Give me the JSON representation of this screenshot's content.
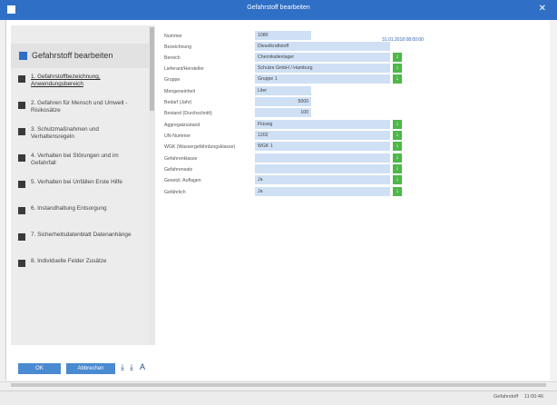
{
  "window": {
    "title": "Gefahrstoff bearbeiten",
    "close_glyph": "✕"
  },
  "sidebar": {
    "header": "Gefahrstoff bearbeiten",
    "items": [
      {
        "label": "1. Gefahrstoffbezeichnung, Anwendungsbereich"
      },
      {
        "label": "2. Gefahren für Mensch und Umwelt - Risikosätze"
      },
      {
        "label": "3. Schutzmaßnahmen und Verhaltensregeln"
      },
      {
        "label": "4. Verhalten bei Störungen und im Gefahrfall"
      },
      {
        "label": "5. Verhalten bei Unfällen Erste Hilfe"
      },
      {
        "label": "6. Instandhaltung Entsorgung"
      },
      {
        "label": "7. Sicherheitsdatenblatt Datenanhänge"
      },
      {
        "label": "8. Individuelle Felder Zusätze"
      }
    ]
  },
  "buttons": {
    "ok": "OK",
    "cancel": "Abbrechen"
  },
  "toolbar": {
    "tool1": "⤓",
    "tool2": "⤓",
    "tool3": "A"
  },
  "form": {
    "date": "31.01.2018 08:00:00",
    "fields": [
      {
        "label": "Nummer",
        "value": "1080",
        "dropdown": false
      },
      {
        "label": "Bezeichnung",
        "value": "Dieselkraftstoff",
        "dropdown": false
      },
      {
        "label": "Bereich",
        "value": "Chemikalienlager",
        "dropdown": true
      },
      {
        "label": "Lieferant/Hersteller",
        "value": "Schulze GmbH / Hamburg",
        "dropdown": true
      },
      {
        "label": "Gruppe",
        "value": "Gruppe 1",
        "dropdown": true
      },
      {
        "label": "Mengeneinheit",
        "value": "Liter",
        "dropdown": false
      },
      {
        "label": "Bedarf (Jahr)",
        "value": "5000",
        "dropdown": false
      },
      {
        "label": "Bestand (Durchschnitt)",
        "value": "100",
        "dropdown": false
      },
      {
        "label": "Aggregatzustand",
        "value": "Flüssig",
        "dropdown": true
      },
      {
        "label": "UN-Nummer",
        "value": "1202",
        "dropdown": true
      },
      {
        "label": "WGK (Wassergefährdungsklasse)",
        "value": "WGK 1",
        "dropdown": true
      },
      {
        "label": "Gefahrenklasse",
        "value": "",
        "dropdown": true
      },
      {
        "label": "Gefahrensatz",
        "value": "",
        "dropdown": true
      },
      {
        "label": "Gesetzl. Auflagen",
        "value": "Ja",
        "dropdown": true
      },
      {
        "label": "Gefährlich",
        "value": "Ja",
        "dropdown": true
      }
    ]
  },
  "status": {
    "left": "Gefahrstoff",
    "right": "11:00:46"
  },
  "dropdown_glyph": "↓"
}
